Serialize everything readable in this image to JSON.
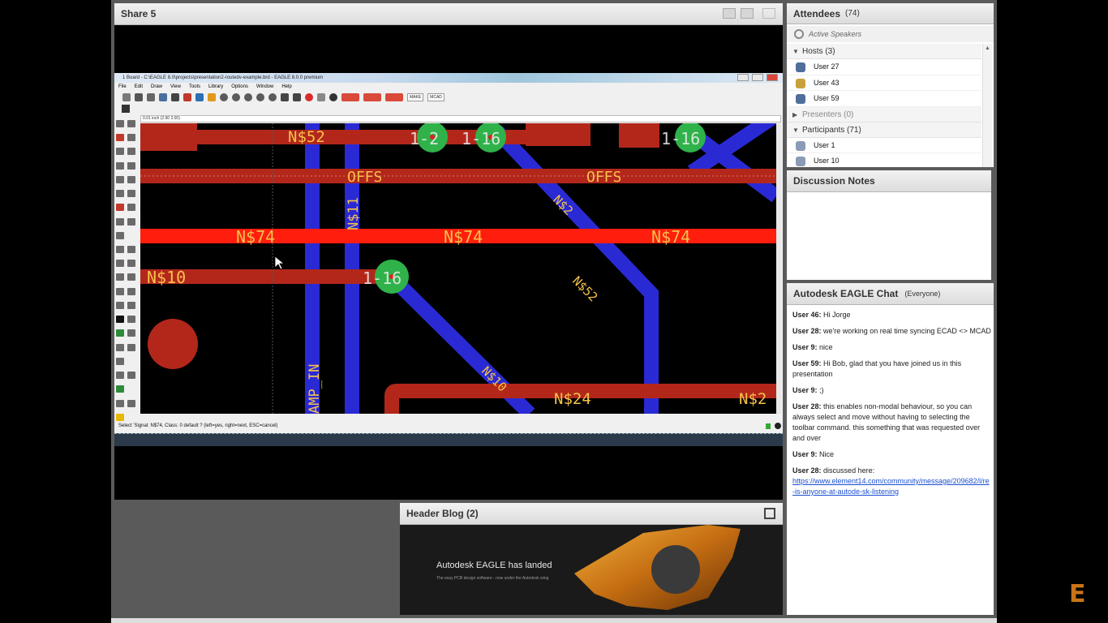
{
  "share_pod": {
    "title": "Share 5"
  },
  "eagle": {
    "window_title": "1 Board - C:\\EAGLE 8.0\\projects\\presentation2-routedv-example.brd - EAGLE 8.0.0 premium",
    "menu": [
      "File",
      "Edit",
      "Draw",
      "View",
      "Tools",
      "Library",
      "Options",
      "Window",
      "Help"
    ],
    "toolbar_labels": [
      "MAKE",
      "MCAD"
    ],
    "coord_readout": "0.01 inch (2.90 3.00)",
    "status_text": "Select 'Signal: N$74, Class: 0 default ? (left=yes, right=next, ESC=cancel)",
    "canvas_labels": {
      "ns52_top": "N$52",
      "offs_1": "OFFS",
      "offs_2": "OFFS",
      "n74_1": "N$74",
      "n74_2": "N$74",
      "n74_3": "N$74",
      "n10": "N$10",
      "n11": "N$11",
      "n2": "N$2",
      "n52_diag": "N$52",
      "n10_diag": "N$10",
      "n24": "N$24",
      "n2_right": "N$2",
      "amp_in": "AMP_IN",
      "pad_1_2": "1-2",
      "pad_1_6a": "1-6",
      "pad_1_6b": "1-16",
      "pad_1_16": "1-16",
      "pad_1_6c": "1-16"
    },
    "colors": {
      "trace_top": "#b3271b",
      "trace_selected": "#ff1e0e",
      "trace_bottom": "#2a2ad4",
      "pad": "#2fb24a",
      "label": "#f5c24a"
    }
  },
  "blog_pod": {
    "title": "Header Blog (2)",
    "banner_title": "Autodesk EAGLE has landed",
    "banner_subtitle": "The easy PCB design software - now under the Autodesk wing"
  },
  "attendees": {
    "title": "Attendees",
    "count": "(74)",
    "active_speakers": "Active Speakers",
    "groups": {
      "hosts": "Hosts (3)",
      "presenters": "Presenters (0)",
      "participants": "Participants (71)"
    },
    "hosts": [
      "User 27",
      "User 43",
      "User 59"
    ],
    "participants": [
      "User 1",
      "User 10"
    ]
  },
  "notes_pod": {
    "title": "Discussion Notes"
  },
  "chat_pod": {
    "title": "Autodesk EAGLE Chat",
    "scope": "(Everyone)",
    "messages": [
      {
        "user": "User 46:",
        "text": "Hi Jorge"
      },
      {
        "user": "User 28:",
        "text": "we're working on real time syncing ECAD <> MCAD"
      },
      {
        "user": "User 9:",
        "text": "nice"
      },
      {
        "user": "User 59:",
        "text": "Hi Bob, glad that you have joined us in this presentation"
      },
      {
        "user": "User 9:",
        "text": ";)"
      },
      {
        "user": "User 28:",
        "text": "this enables non-modal behaviour, so you can always select and move without having to selecting the toolbar command.  this something that was requested over and over"
      },
      {
        "user": "User 9:",
        "text": "Nice"
      },
      {
        "user": "User 28:",
        "text": "discussed here:",
        "link": "https://www.element14.com/community/message/209682/l/re-is-anyone-at-autode-sk-listening"
      }
    ]
  },
  "brand": {
    "logo_letter": "E",
    "logo_color": "#c8741a"
  }
}
